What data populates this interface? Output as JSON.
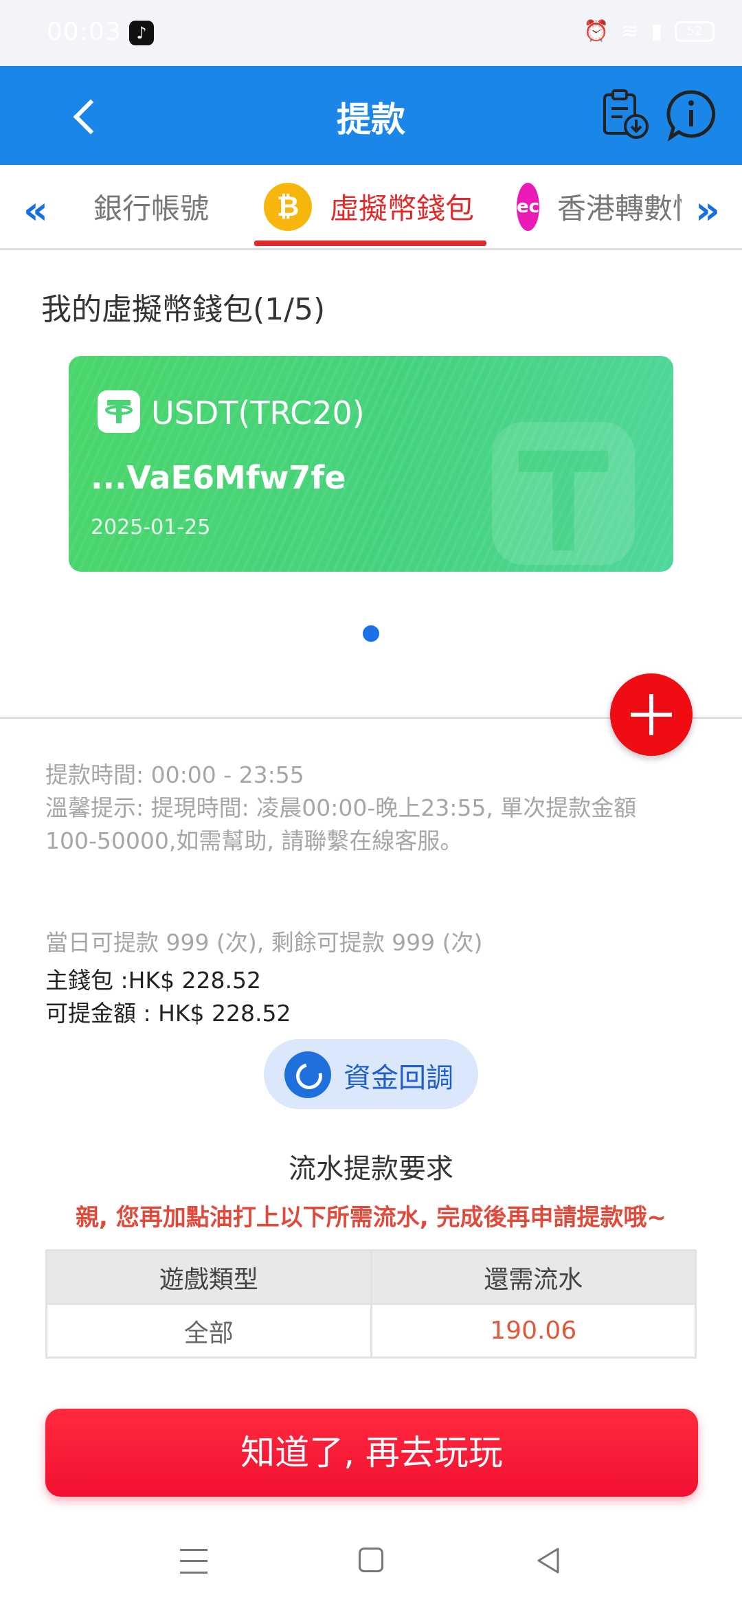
{
  "status_bar": {
    "time": "00:03",
    "battery": "52"
  },
  "header": {
    "title": "提款"
  },
  "tabs": [
    {
      "label": "銀行帳號",
      "icon": "bank-icon",
      "active": false
    },
    {
      "label": "虛擬幣錢包",
      "icon": "bitcoin-icon",
      "active": true
    },
    {
      "label": "香港轉數快",
      "icon": "ec-wallet-icon",
      "active": false
    }
  ],
  "tab_icons": {
    "btc": "₿",
    "ec": "ec"
  },
  "wallets": {
    "title": "我的虛擬幣錢包(1/5)",
    "cards": [
      {
        "name": "USDT(TRC20)",
        "address": "...VaE6Mfw7fe",
        "date": "2025-01-25"
      }
    ]
  },
  "info": {
    "time_line": "提款時間:   00:00 - 23:55",
    "tip_line": "溫馨提示:  提現時間: 凌晨00:00-晚上23:55, 單次提款金額100-50000,如需幫助, 請聯繫在線客服。",
    "count_line": "當日可提款 999 (次), 剩餘可提款 999 (次)",
    "main_wallet": "主錢包 :HK$ 228.52",
    "withdrawable": "可提金額 : HK$ 228.52"
  },
  "callback_button": {
    "label": "資金回調"
  },
  "requirements": {
    "title": "流水提款要求",
    "note": "親, 您再加點油打上以下所需流水, 完成後再申請提款哦~",
    "headers": [
      "遊戲類型",
      "還需流水"
    ],
    "rows": [
      {
        "type": "全部",
        "remaining": "190.06"
      }
    ]
  },
  "ok_button": {
    "label": "知道了, 再去玩玩"
  },
  "colors": {
    "header": "#1a87e8",
    "accent_red": "#e02a2a",
    "card_green": "#48d474",
    "button_red": "#f21030"
  }
}
